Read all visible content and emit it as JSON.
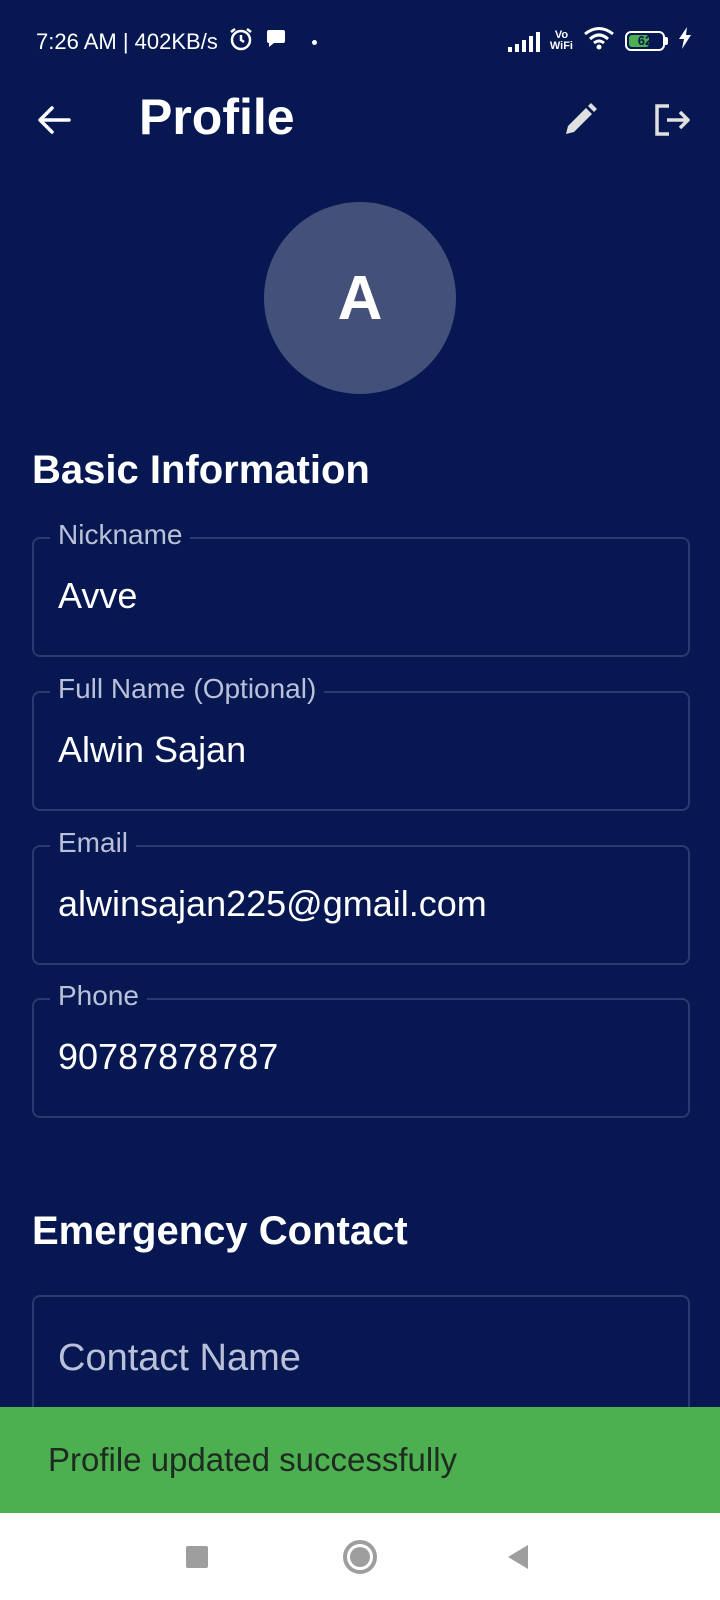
{
  "status_bar": {
    "time_speed": "7:26 AM | 402KB/s",
    "vowifi_top": "Vo",
    "vowifi_bottom": "WiFi",
    "battery_level": "62",
    "battery_fraction": 0.62
  },
  "app_bar": {
    "title": "Profile",
    "back_icon": "arrow-left-icon",
    "edit_icon": "pencil-icon",
    "logout_icon": "logout-icon"
  },
  "avatar": {
    "initial": "A"
  },
  "basic_info": {
    "title": "Basic Information",
    "fields": [
      {
        "label": "Nickname",
        "value": "Avve"
      },
      {
        "label": "Full Name (Optional)",
        "value": "Alwin Sajan"
      },
      {
        "label": "Email",
        "value": "alwinsajan225@gmail.com"
      },
      {
        "label": "Phone",
        "value": "90787878787"
      }
    ]
  },
  "emergency": {
    "title": "Emergency Contact",
    "contact_name_placeholder": "Contact Name"
  },
  "snackbar": {
    "message": "Profile updated successfully"
  },
  "colors": {
    "background": "#061752",
    "snackbar": "#4caf50",
    "avatar": "#43507a",
    "field_border": "#2a3a70"
  }
}
